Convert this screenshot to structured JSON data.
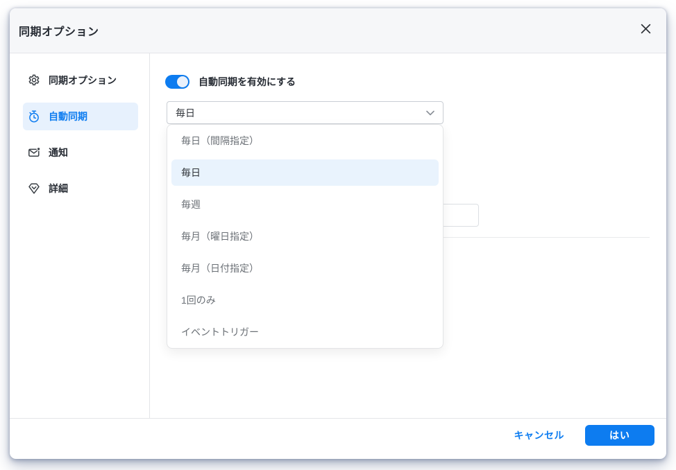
{
  "dialog": {
    "title": "同期オプション"
  },
  "sidebar": {
    "items": [
      {
        "name": "sync-options",
        "icon": "gear-icon",
        "label": "同期オプション",
        "selected": false
      },
      {
        "name": "auto-sync",
        "icon": "stopwatch-icon",
        "label": "自動同期",
        "selected": true
      },
      {
        "name": "notification",
        "icon": "mail-notification-icon",
        "label": "通知",
        "selected": false
      },
      {
        "name": "advanced",
        "icon": "gem-icon",
        "label": "詳細",
        "selected": false
      }
    ]
  },
  "main": {
    "auto_sync_toggle": {
      "label": "自動同期を有効にする",
      "state": "on"
    },
    "frequency_select": {
      "value": "毎日"
    },
    "dropdown": {
      "options": [
        "毎日（間隔指定）",
        "毎日",
        "毎週",
        "毎月（曜日指定）",
        "毎月（日付指定）",
        "1回のみ",
        "イベントトリガー"
      ],
      "selected_index": 1
    }
  },
  "footer": {
    "cancel_label": "キャンセル",
    "ok_label": "はい"
  },
  "colors": {
    "accent": "#0d7cf0",
    "sidebar_selected_bg": "#e7f1fd",
    "dropdown_selected_bg": "#e9f3fd",
    "titlebar_bg": "#f6f7f9"
  }
}
